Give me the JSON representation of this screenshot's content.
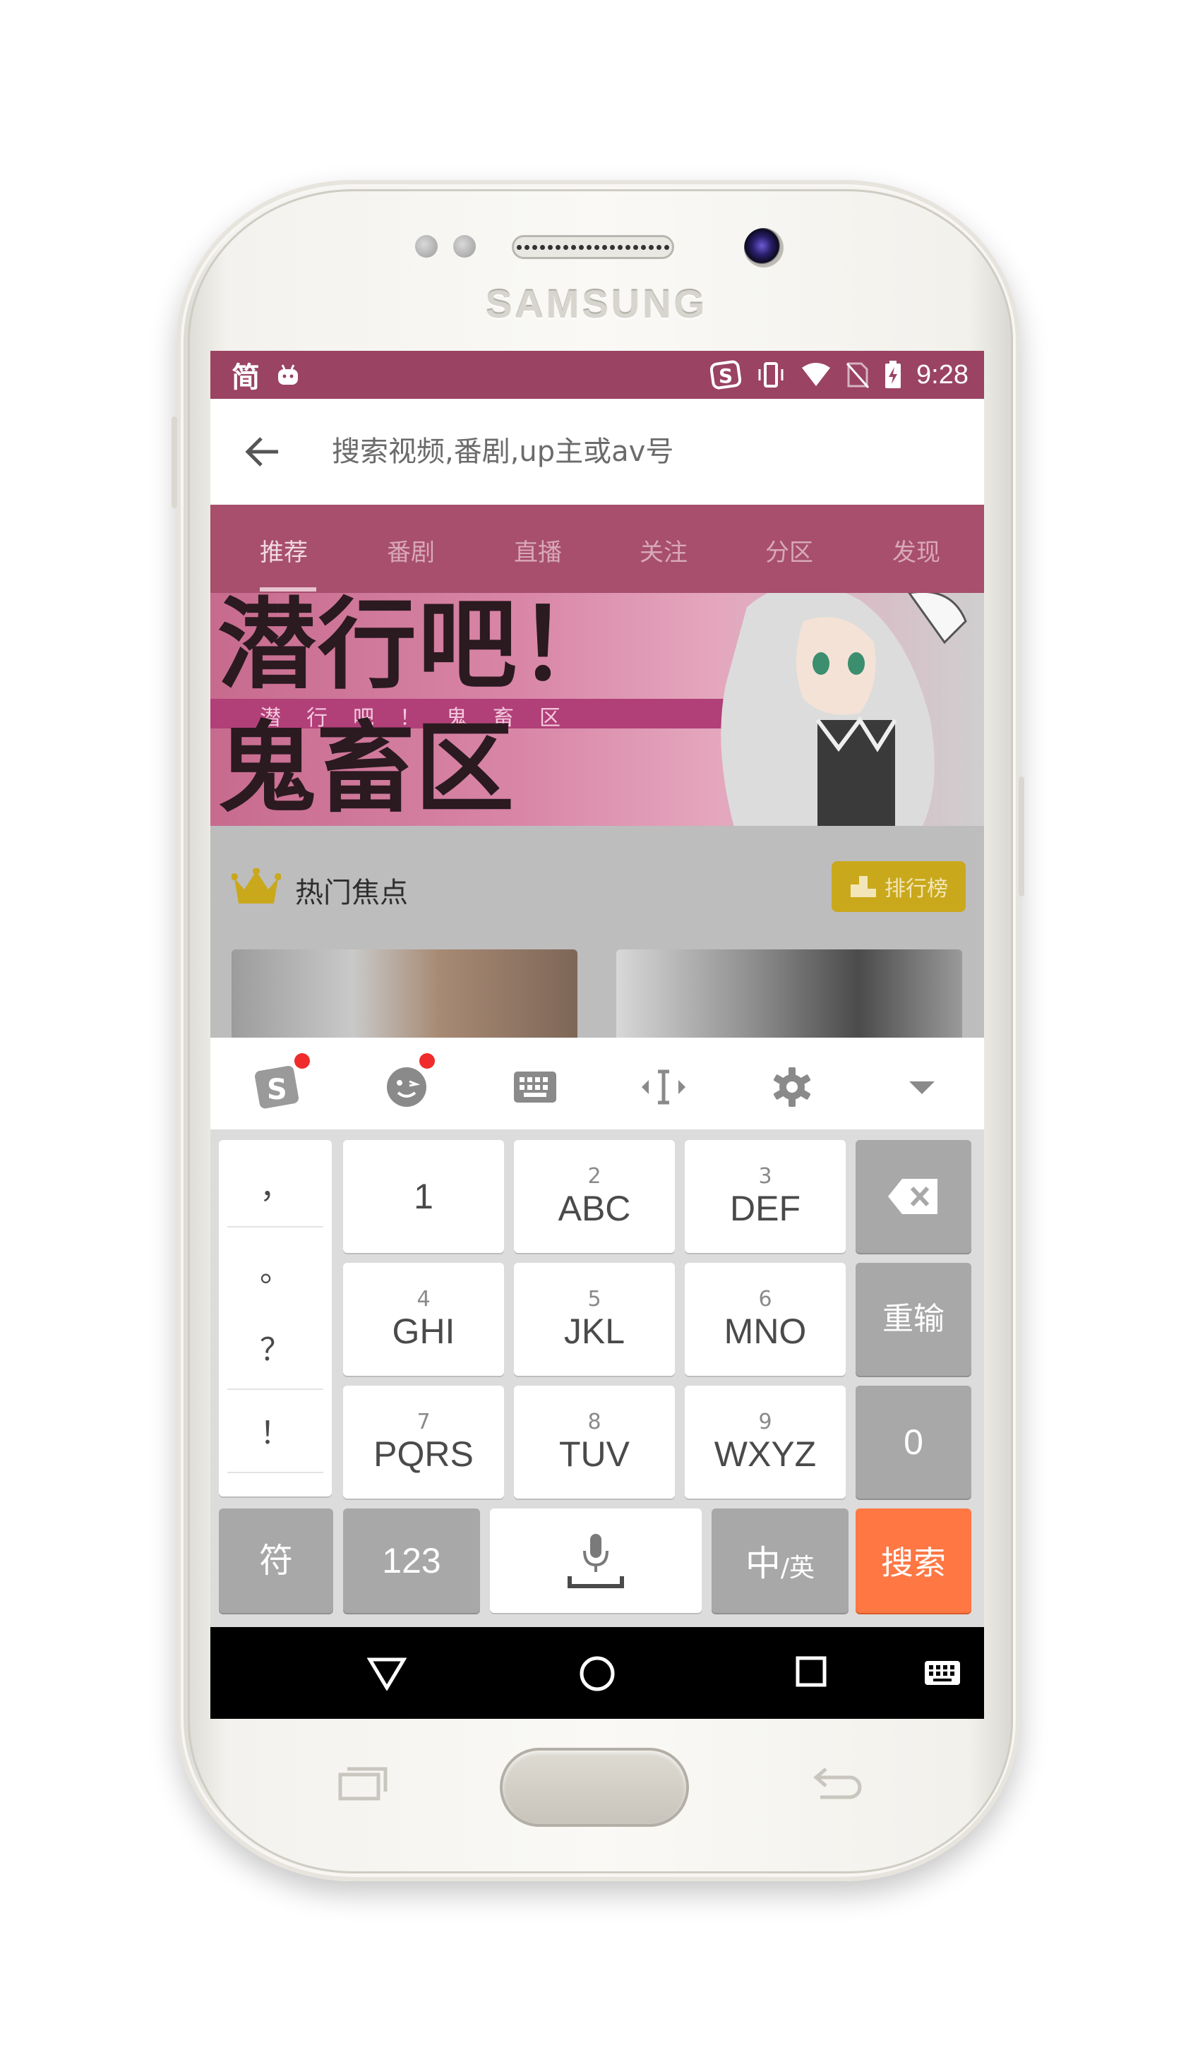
{
  "device": {
    "brand": "SAMSUNG"
  },
  "status_bar": {
    "ime_indicator": "简",
    "left_icons": [
      "android-debug-icon"
    ],
    "right_icons": [
      "sogou-icon",
      "vibrate-icon",
      "wifi-icon",
      "no-sim-icon",
      "battery-charging-icon"
    ],
    "time": "9:28",
    "color": "#9a4363"
  },
  "search": {
    "placeholder": "搜索视频,番剧,up主或av号",
    "value": ""
  },
  "tabs": [
    "推荐",
    "番剧",
    "直播",
    "关注",
    "分区",
    "发现"
  ],
  "active_tab": "推荐",
  "banner": {
    "title_line1": "潜行吧！",
    "title_line2": "鬼畜区",
    "subtitle": "潜行吧！鬼畜区"
  },
  "hot": {
    "title": "热门焦点",
    "rank_button": "排行榜"
  },
  "keyboard": {
    "toolbar_icons": [
      "sogou-logo-icon",
      "emoji-icon",
      "keyboard-icon",
      "cursor-move-icon",
      "settings-icon",
      "collapse-icon"
    ],
    "punctuation": [
      "，",
      "。",
      "？",
      "！"
    ],
    "rows": [
      [
        {
          "num": "",
          "let": "1"
        },
        {
          "num": "2",
          "let": "ABC"
        },
        {
          "num": "3",
          "let": "DEF"
        }
      ],
      [
        {
          "num": "4",
          "let": "GHI"
        },
        {
          "num": "5",
          "let": "JKL"
        },
        {
          "num": "6",
          "let": "MNO"
        }
      ],
      [
        {
          "num": "7",
          "let": "PQRS"
        },
        {
          "num": "8",
          "let": "TUV"
        },
        {
          "num": "9",
          "let": "WXYZ"
        }
      ]
    ],
    "right_keys": {
      "reinput": "重输",
      "zero": "0"
    },
    "bottom": {
      "symbols": "符",
      "numbers": "123",
      "lang_main": "中",
      "lang_alt": "/英",
      "search": "搜索"
    },
    "accent": "#ff7743"
  },
  "nav_bar": {
    "icons": [
      "back-icon",
      "home-icon",
      "recents-icon",
      "keyboard-switch-icon"
    ]
  }
}
